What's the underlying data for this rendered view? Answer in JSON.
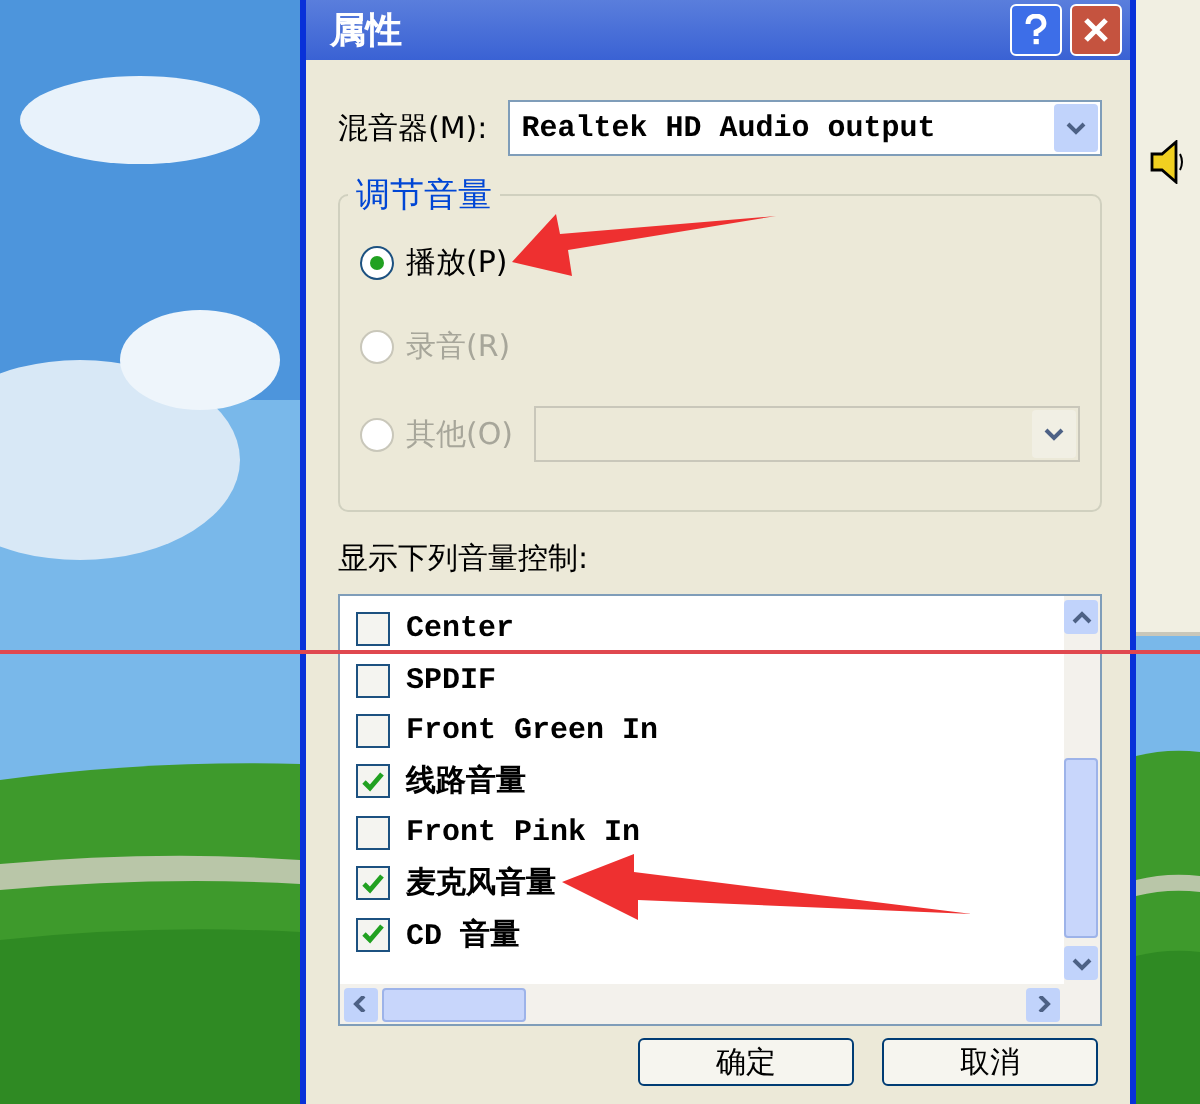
{
  "dialog": {
    "title": "属性"
  },
  "mixer": {
    "label": "混音器(M):",
    "value": "Realtek HD Audio output"
  },
  "volume_group": {
    "title": "调节音量",
    "options": [
      {
        "label": "播放(P)",
        "selected": true,
        "disabled": false,
        "kind": "plain"
      },
      {
        "label": "录音(R)",
        "selected": false,
        "disabled": true,
        "kind": "plain"
      },
      {
        "label": "其他(O)",
        "selected": false,
        "disabled": true,
        "kind": "dropdown"
      }
    ]
  },
  "controls_label": "显示下列音量控制:",
  "controls": [
    {
      "label": "Center",
      "checked": false
    },
    {
      "label": "SPDIF",
      "checked": false
    },
    {
      "label": "Front Green In",
      "checked": false
    },
    {
      "label": "线路音量",
      "checked": true
    },
    {
      "label": "Front Pink In",
      "checked": false
    },
    {
      "label": "麦克风音量",
      "checked": true
    },
    {
      "label": "CD 音量",
      "checked": true
    }
  ],
  "buttons": [
    "确定",
    "取消"
  ],
  "annotations": [
    {
      "kind": "arrow"
    },
    {
      "kind": "arrow"
    },
    {
      "kind": "line"
    }
  ]
}
